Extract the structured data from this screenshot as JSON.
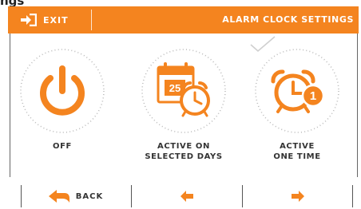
{
  "page_heading": "ngs",
  "header": {
    "exit_label": "EXIT",
    "title": "ALARM CLOCK SETTINGS",
    "exit_icon": "exit-icon",
    "bg_color": "#f4841f"
  },
  "options": [
    {
      "label": "OFF",
      "icon": "power-icon"
    },
    {
      "label": "ACTIVE ON\nSELECTED DAYS",
      "icon": "calendar-alarm-icon",
      "calendar_day": "25"
    },
    {
      "label": "ACTIVE\nONE TIME",
      "icon": "alarm-one-time-icon",
      "badge": "1"
    }
  ],
  "footer": {
    "back_label": "BACK",
    "back_icon": "back-arrow-icon",
    "prev_icon": "arrow-left-icon",
    "next_icon": "arrow-right-icon"
  },
  "colors": {
    "accent": "#f4841f",
    "text": "#333333"
  }
}
